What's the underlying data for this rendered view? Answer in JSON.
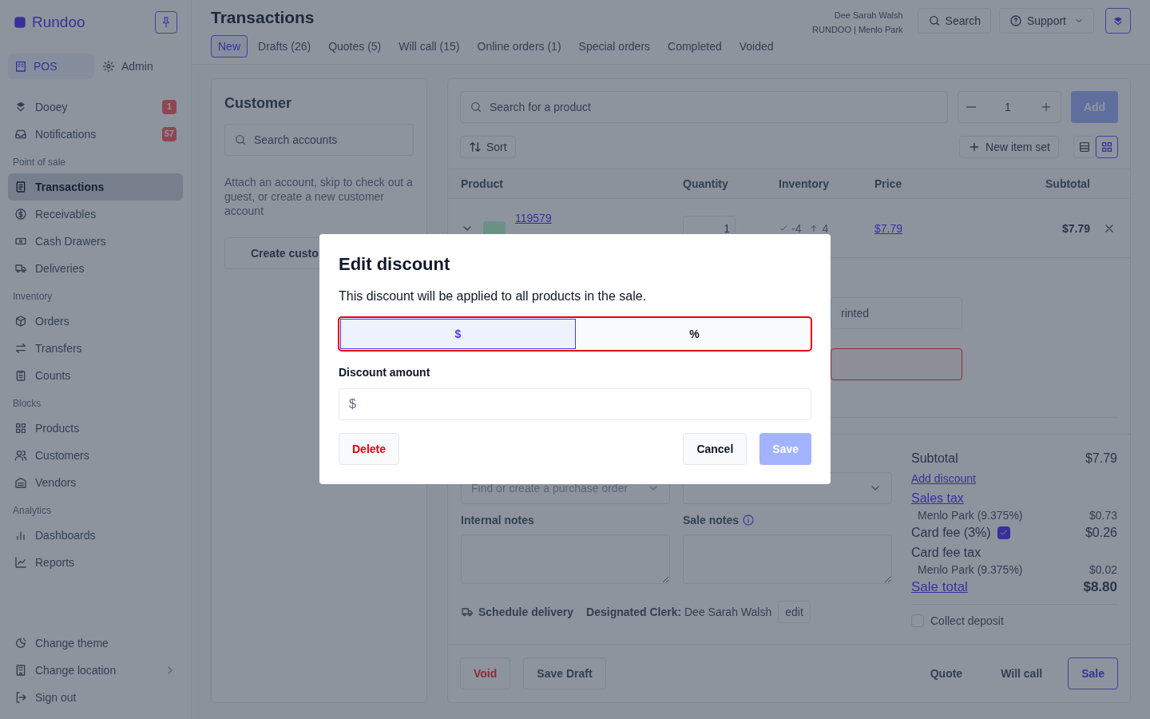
{
  "sidebar": {
    "logo": "Rundoo",
    "modes": [
      {
        "label": "POS",
        "selected": true
      },
      {
        "label": "Admin",
        "selected": false
      }
    ],
    "top_items": [
      {
        "label": "Dooey",
        "badge": "1"
      },
      {
        "label": "Notifications",
        "badge": "57"
      }
    ],
    "sections": [
      {
        "title": "Point of sale",
        "items": [
          {
            "label": "Transactions",
            "selected": true
          },
          {
            "label": "Receivables",
            "selected": false
          },
          {
            "label": "Cash Drawers",
            "selected": false
          },
          {
            "label": "Deliveries",
            "selected": false
          }
        ]
      },
      {
        "title": "Inventory",
        "items": [
          {
            "label": "Orders",
            "selected": false
          },
          {
            "label": "Transfers",
            "selected": false
          },
          {
            "label": "Counts",
            "selected": false
          }
        ]
      },
      {
        "title": "Blocks",
        "items": [
          {
            "label": "Products",
            "selected": false
          },
          {
            "label": "Customers",
            "selected": false
          },
          {
            "label": "Vendors",
            "selected": false
          }
        ]
      },
      {
        "title": "Analytics",
        "items": [
          {
            "label": "Dashboards",
            "selected": false
          },
          {
            "label": "Reports",
            "selected": false
          }
        ]
      }
    ],
    "bottom_items": [
      {
        "label": "Change theme",
        "kind": "plain"
      },
      {
        "label": "Change location",
        "kind": "submenu"
      },
      {
        "label": "Sign out",
        "kind": "plain"
      }
    ]
  },
  "header": {
    "title": "Transactions",
    "user": "Dee Sarah Walsh",
    "store": "RUNDOO | Menlo Park",
    "search": "Search",
    "support": "Support",
    "tabs": [
      {
        "label": "New",
        "selected": true
      },
      {
        "label": "Drafts (26)",
        "selected": false
      },
      {
        "label": "Quotes (5)",
        "selected": false
      },
      {
        "label": "Will call (15)",
        "selected": false
      },
      {
        "label": "Online orders (1)",
        "selected": false
      },
      {
        "label": "Special orders",
        "selected": false
      },
      {
        "label": "Completed",
        "selected": false
      },
      {
        "label": "Voided",
        "selected": false
      }
    ]
  },
  "customer": {
    "title": "Customer",
    "search_placeholder": "Search accounts",
    "help": "Attach an account, skip to check out a guest, or create a new customer account",
    "create_button": "Create custo"
  },
  "products": {
    "search_placeholder": "Search for a product",
    "quantity": "1",
    "add": "Add",
    "sort": "Sort",
    "new_item_set": "New item set",
    "views": [
      {
        "kind": "list",
        "selected": false
      },
      {
        "kind": "grid",
        "selected": true
      }
    ],
    "columns": [
      "Product",
      "Quantity",
      "Inventory",
      "Price",
      "Subtotal"
    ],
    "rows": [
      {
        "sku": "119579",
        "quantity": "1",
        "in_stock": "-4",
        "incoming": "4",
        "price": "$7.79",
        "subtotal": "$7.79",
        "expanded": true
      }
    ],
    "detail_fields": [
      {
        "placeholder": "rinted",
        "error": false
      },
      {
        "error": true
      }
    ]
  },
  "order": {
    "purchase_order_placeholder": "Find or create a purchase order",
    "internal_notes": "Internal notes",
    "sale_notes": "Sale notes",
    "schedule_delivery": "Schedule delivery",
    "clerk": "**Designated Clerk:** Dee Sarah Walsh",
    "clerk_edit": "edit",
    "summary": [
      {
        "kind": "line",
        "label": "Subtotal",
        "value": "$7.79"
      },
      {
        "kind": "link",
        "label": "Add discount"
      },
      {
        "kind": "heading_link",
        "label": "Sales tax"
      },
      {
        "kind": "sub",
        "label": "Menlo Park (9.375%)",
        "value": "$0.73"
      },
      {
        "kind": "check",
        "label": "Card fee (3%)",
        "value": "$0.26",
        "checked": true
      },
      {
        "kind": "line",
        "label": "Card fee tax"
      },
      {
        "kind": "sub",
        "label": "Menlo Park (9.375%)",
        "value": "$0.02"
      },
      {
        "kind": "total",
        "label": "Sale total",
        "value": "$8.80"
      }
    ],
    "collect_deposit": {
      "label": "Collect deposit",
      "checked": false
    }
  },
  "footer": {
    "void": "Void",
    "save_draft": "Save Draft",
    "quote": "Quote",
    "will_call": "Will call",
    "sale": "Sale"
  },
  "modal": {
    "title": "Edit discount",
    "text": "This discount will be applied to all products in the sale.",
    "segments": [
      {
        "label": "$",
        "selected": true
      },
      {
        "label": "%",
        "selected": false
      }
    ],
    "amount_label": "Discount amount",
    "amount_prefix": "$",
    "delete": "Delete",
    "cancel": "Cancel",
    "save": "Save",
    "save_disabled": true
  }
}
